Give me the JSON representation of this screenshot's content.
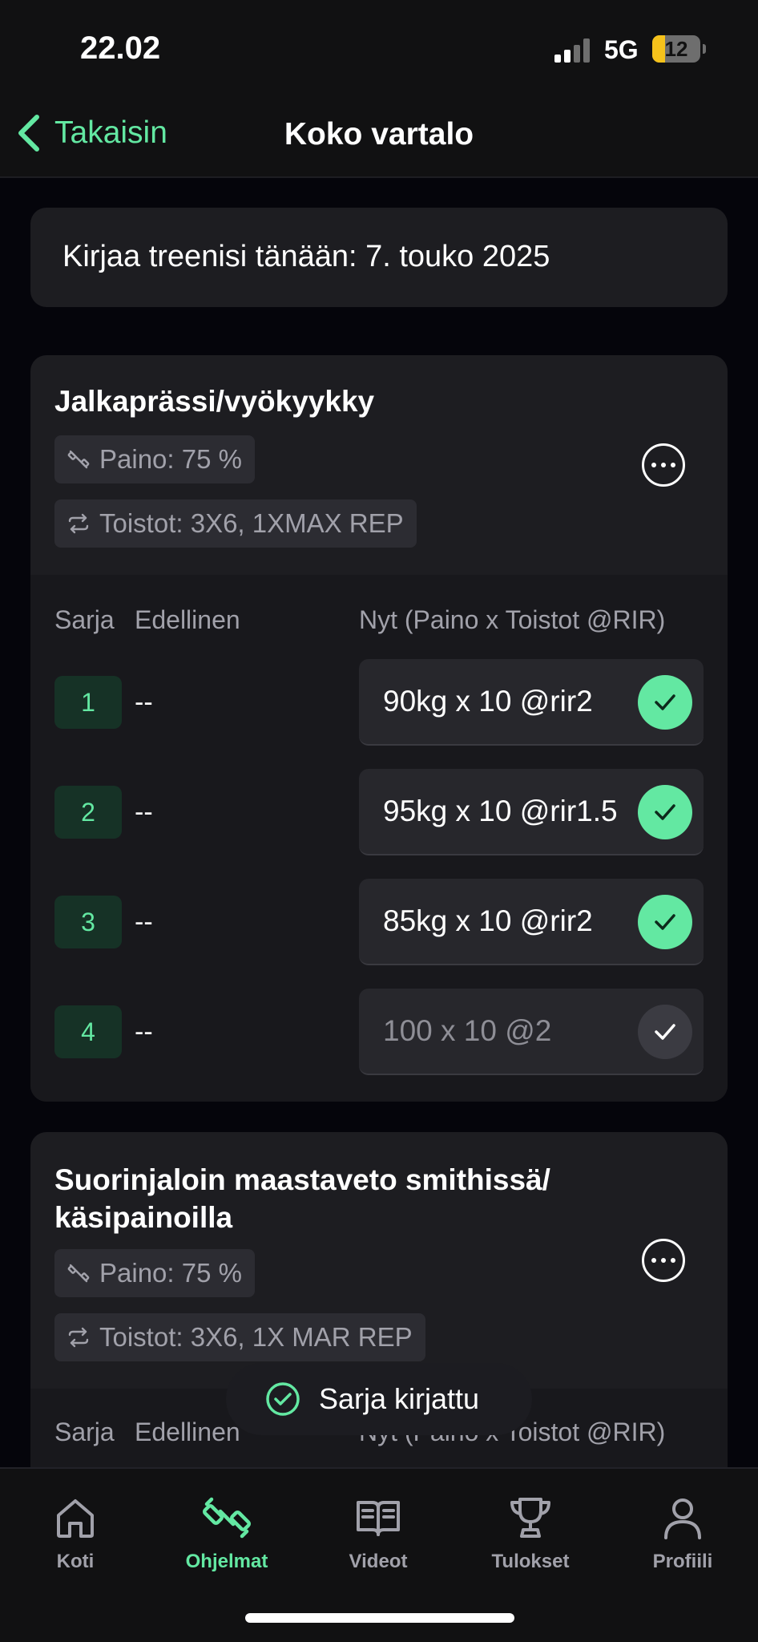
{
  "status": {
    "time": "22.02",
    "network": "5G",
    "battery": "12"
  },
  "nav": {
    "back_label": "Takaisin",
    "title": "Koko vartalo"
  },
  "date_card": {
    "text": "Kirjaa treenisi tänään: 7. touko 2025"
  },
  "exercises": [
    {
      "name": "Jalkaprässi/vyökyykky",
      "weight_chip": "Paino: 75 %",
      "reps_chip": "Toistot: 3X6, 1XMAX REP",
      "headers": {
        "set": "Sarja",
        "previous": "Edellinen",
        "now": "Nyt (Paino x Toistot @RIR)"
      },
      "sets": [
        {
          "num": "1",
          "prev": "--",
          "value": "90kg x 10 @rir2",
          "done": true
        },
        {
          "num": "2",
          "prev": "--",
          "value": "95kg x 10 @rir1.5",
          "done": true
        },
        {
          "num": "3",
          "prev": "--",
          "value": "85kg x 10 @rir2",
          "done": true
        },
        {
          "num": "4",
          "prev": "--",
          "value": "100 x 10 @2",
          "done": false
        }
      ]
    },
    {
      "name_line1": "Suorinjaloin maastaveto smithissä/",
      "name_line2": "käsipainoilla",
      "weight_chip": "Paino: 75 %",
      "reps_chip": "Toistot: 3X6, 1X MAR REP",
      "headers": {
        "set": "Sarja",
        "previous": "Edellinen",
        "now": "Nyt (Paino x Toistot @RIR)"
      }
    }
  ],
  "toast": {
    "text": "Sarja kirjattu"
  },
  "tabs": [
    {
      "label": "Koti",
      "icon": "home-icon",
      "active": false
    },
    {
      "label": "Ohjelmat",
      "icon": "dumbbell-icon",
      "active": true
    },
    {
      "label": "Videot",
      "icon": "book-icon",
      "active": false
    },
    {
      "label": "Tulokset",
      "icon": "trophy-icon",
      "active": false
    },
    {
      "label": "Profiili",
      "icon": "person-icon",
      "active": false
    }
  ],
  "colors": {
    "accent": "#63e8a2",
    "card": "#1d1d21",
    "background": "#05050b"
  }
}
